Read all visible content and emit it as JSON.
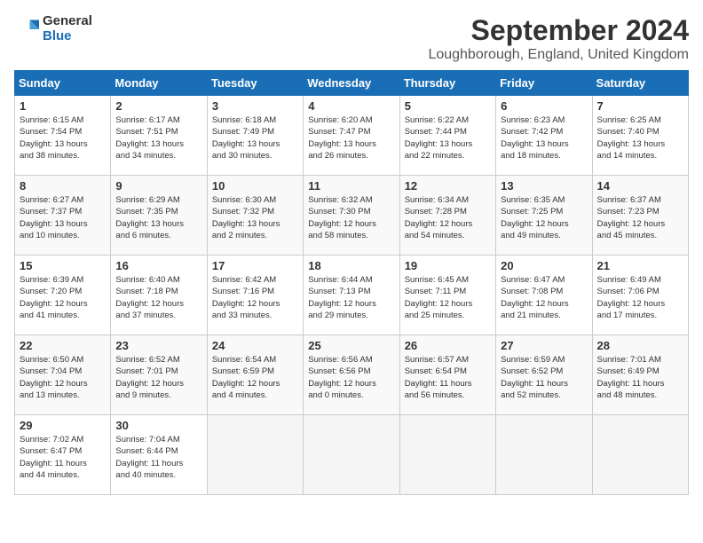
{
  "logo": {
    "general": "General",
    "blue": "Blue"
  },
  "title": "September 2024",
  "subtitle": "Loughborough, England, United Kingdom",
  "days_header": [
    "Sunday",
    "Monday",
    "Tuesday",
    "Wednesday",
    "Thursday",
    "Friday",
    "Saturday"
  ],
  "weeks": [
    [
      {
        "num": "1",
        "info": "Sunrise: 6:15 AM\nSunset: 7:54 PM\nDaylight: 13 hours\nand 38 minutes."
      },
      {
        "num": "2",
        "info": "Sunrise: 6:17 AM\nSunset: 7:51 PM\nDaylight: 13 hours\nand 34 minutes."
      },
      {
        "num": "3",
        "info": "Sunrise: 6:18 AM\nSunset: 7:49 PM\nDaylight: 13 hours\nand 30 minutes."
      },
      {
        "num": "4",
        "info": "Sunrise: 6:20 AM\nSunset: 7:47 PM\nDaylight: 13 hours\nand 26 minutes."
      },
      {
        "num": "5",
        "info": "Sunrise: 6:22 AM\nSunset: 7:44 PM\nDaylight: 13 hours\nand 22 minutes."
      },
      {
        "num": "6",
        "info": "Sunrise: 6:23 AM\nSunset: 7:42 PM\nDaylight: 13 hours\nand 18 minutes."
      },
      {
        "num": "7",
        "info": "Sunrise: 6:25 AM\nSunset: 7:40 PM\nDaylight: 13 hours\nand 14 minutes."
      }
    ],
    [
      {
        "num": "8",
        "info": "Sunrise: 6:27 AM\nSunset: 7:37 PM\nDaylight: 13 hours\nand 10 minutes."
      },
      {
        "num": "9",
        "info": "Sunrise: 6:29 AM\nSunset: 7:35 PM\nDaylight: 13 hours\nand 6 minutes."
      },
      {
        "num": "10",
        "info": "Sunrise: 6:30 AM\nSunset: 7:32 PM\nDaylight: 13 hours\nand 2 minutes."
      },
      {
        "num": "11",
        "info": "Sunrise: 6:32 AM\nSunset: 7:30 PM\nDaylight: 12 hours\nand 58 minutes."
      },
      {
        "num": "12",
        "info": "Sunrise: 6:34 AM\nSunset: 7:28 PM\nDaylight: 12 hours\nand 54 minutes."
      },
      {
        "num": "13",
        "info": "Sunrise: 6:35 AM\nSunset: 7:25 PM\nDaylight: 12 hours\nand 49 minutes."
      },
      {
        "num": "14",
        "info": "Sunrise: 6:37 AM\nSunset: 7:23 PM\nDaylight: 12 hours\nand 45 minutes."
      }
    ],
    [
      {
        "num": "15",
        "info": "Sunrise: 6:39 AM\nSunset: 7:20 PM\nDaylight: 12 hours\nand 41 minutes."
      },
      {
        "num": "16",
        "info": "Sunrise: 6:40 AM\nSunset: 7:18 PM\nDaylight: 12 hours\nand 37 minutes."
      },
      {
        "num": "17",
        "info": "Sunrise: 6:42 AM\nSunset: 7:16 PM\nDaylight: 12 hours\nand 33 minutes."
      },
      {
        "num": "18",
        "info": "Sunrise: 6:44 AM\nSunset: 7:13 PM\nDaylight: 12 hours\nand 29 minutes."
      },
      {
        "num": "19",
        "info": "Sunrise: 6:45 AM\nSunset: 7:11 PM\nDaylight: 12 hours\nand 25 minutes."
      },
      {
        "num": "20",
        "info": "Sunrise: 6:47 AM\nSunset: 7:08 PM\nDaylight: 12 hours\nand 21 minutes."
      },
      {
        "num": "21",
        "info": "Sunrise: 6:49 AM\nSunset: 7:06 PM\nDaylight: 12 hours\nand 17 minutes."
      }
    ],
    [
      {
        "num": "22",
        "info": "Sunrise: 6:50 AM\nSunset: 7:04 PM\nDaylight: 12 hours\nand 13 minutes."
      },
      {
        "num": "23",
        "info": "Sunrise: 6:52 AM\nSunset: 7:01 PM\nDaylight: 12 hours\nand 9 minutes."
      },
      {
        "num": "24",
        "info": "Sunrise: 6:54 AM\nSunset: 6:59 PM\nDaylight: 12 hours\nand 4 minutes."
      },
      {
        "num": "25",
        "info": "Sunrise: 6:56 AM\nSunset: 6:56 PM\nDaylight: 12 hours\nand 0 minutes."
      },
      {
        "num": "26",
        "info": "Sunrise: 6:57 AM\nSunset: 6:54 PM\nDaylight: 11 hours\nand 56 minutes."
      },
      {
        "num": "27",
        "info": "Sunrise: 6:59 AM\nSunset: 6:52 PM\nDaylight: 11 hours\nand 52 minutes."
      },
      {
        "num": "28",
        "info": "Sunrise: 7:01 AM\nSunset: 6:49 PM\nDaylight: 11 hours\nand 48 minutes."
      }
    ],
    [
      {
        "num": "29",
        "info": "Sunrise: 7:02 AM\nSunset: 6:47 PM\nDaylight: 11 hours\nand 44 minutes."
      },
      {
        "num": "30",
        "info": "Sunrise: 7:04 AM\nSunset: 6:44 PM\nDaylight: 11 hours\nand 40 minutes."
      },
      {
        "num": "",
        "info": ""
      },
      {
        "num": "",
        "info": ""
      },
      {
        "num": "",
        "info": ""
      },
      {
        "num": "",
        "info": ""
      },
      {
        "num": "",
        "info": ""
      }
    ]
  ]
}
